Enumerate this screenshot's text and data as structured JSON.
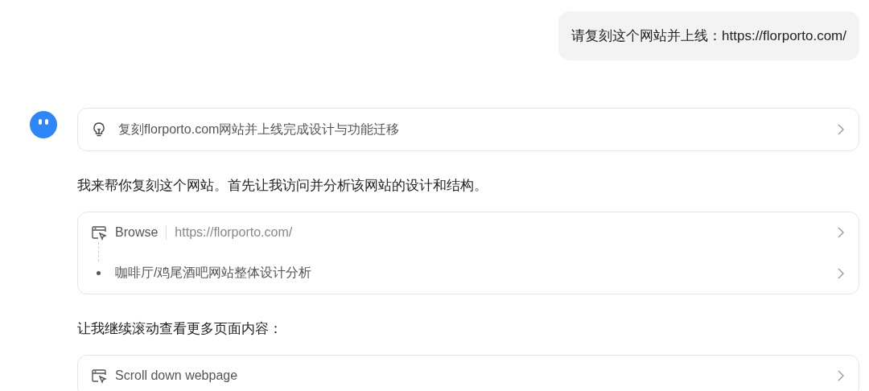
{
  "user_message": {
    "text": "请复刻这个网站并上线：https://florporto.com/"
  },
  "plan": {
    "title": "复刻florporto.com网站并上线完成设计与功能迁移"
  },
  "blocks": [
    {
      "kind": "text",
      "text": "我来帮你复刻这个网站。首先让我访问并分析该网站的设计和结构。"
    },
    {
      "kind": "tool",
      "tool": "Browse",
      "url": "https://florporto.com/",
      "steps": [
        "咖啡厅/鸡尾酒吧网站整体设计分析"
      ]
    },
    {
      "kind": "text",
      "text": "让我继续滚动查看更多页面内容："
    },
    {
      "kind": "tool",
      "tool": "Scroll down webpage"
    }
  ]
}
